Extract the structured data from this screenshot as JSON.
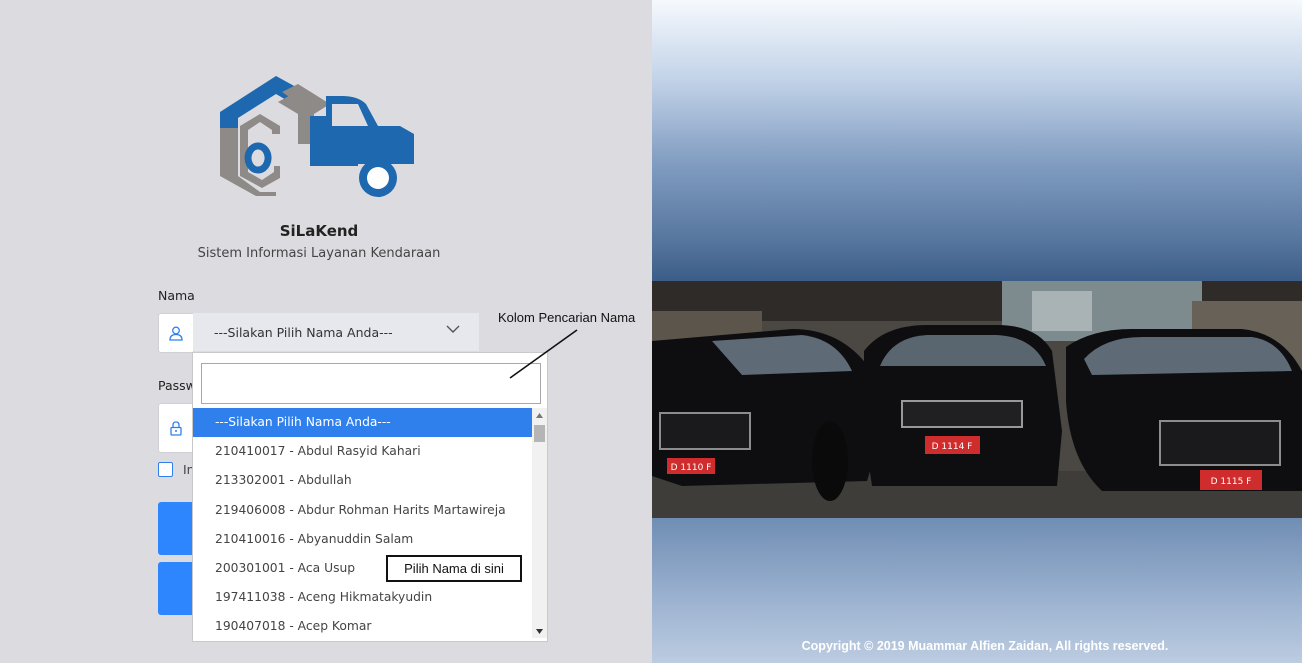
{
  "app": {
    "name": "SiLaKend",
    "subtitle": "Sistem Informasi Layanan Kendaraan"
  },
  "form": {
    "name_label": "Nama",
    "name_select_value": "---Silakan Pilih Nama Anda---",
    "password_label": "Passw",
    "remember_label": "In"
  },
  "dropdown": {
    "search_value": "",
    "options": [
      "---Silakan Pilih Nama Anda---",
      "210410017 - Abdul Rasyid Kahari",
      "213302001 - Abdullah",
      "219406008 - Abdur Rohman Harits Martawireja",
      "210410016 - Abyanuddin Salam",
      "200301001 - Aca Usup",
      "197411038 - Aceng Hikmatakyudin",
      "190407018 - Acep Komar"
    ],
    "selected_index": 0
  },
  "annotations": {
    "search_note": "Kolom Pencarian Nama",
    "pick_note": "Pilih Nama di sini"
  },
  "photo": {
    "plates": [
      "D 1110 F",
      "D 1114 F",
      "D 1115 F"
    ]
  },
  "footer": {
    "copyright": "Copyright © 2019 Muammar Alfien Zaidan, All rights reserved."
  },
  "icons": {
    "logo": "car-garage-logo",
    "user": "user-icon",
    "lock": "lock-icon",
    "chevron": "chevron-down-icon"
  },
  "colors": {
    "accent": "#2f80ed",
    "logo_blue": "#1d68ae",
    "logo_gray": "#8e8a87",
    "left_bg": "#dcdbe0"
  }
}
